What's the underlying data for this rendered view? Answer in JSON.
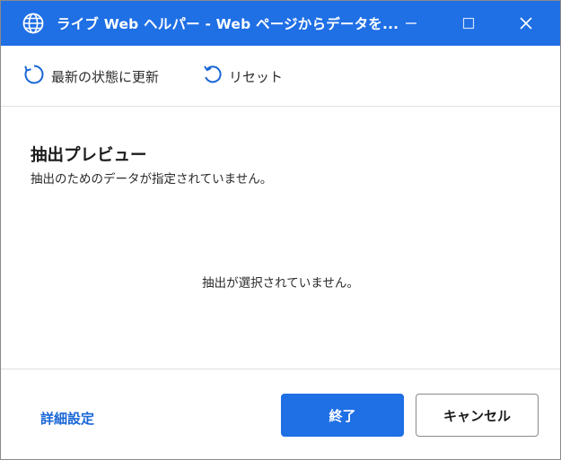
{
  "window": {
    "title": "ライブ Web ヘルパー - Web ページからデータを...",
    "colors": {
      "accent": "#1f6fe5",
      "link": "#1866d6"
    }
  },
  "toolbar": {
    "refresh_label": "最新の状態に更新",
    "refresh_icon": "refresh-icon",
    "reset_label": "リセット",
    "reset_icon": "undo-icon"
  },
  "preview": {
    "title": "抽出プレビュー",
    "subtitle": "抽出のためのデータが指定されていません。",
    "empty_message": "抽出が選択されていません。"
  },
  "footer": {
    "advanced_label": "詳細設定",
    "finish_label": "終了",
    "cancel_label": "キャンセル"
  }
}
